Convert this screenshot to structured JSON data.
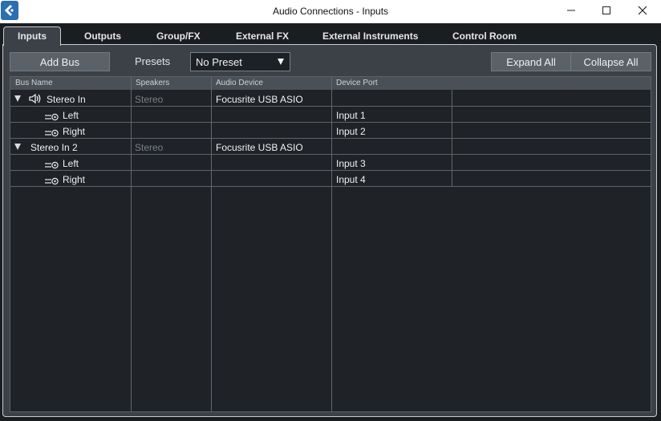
{
  "window": {
    "title": "Audio Connections - Inputs"
  },
  "tabs": [
    {
      "label": "Inputs",
      "active": true
    },
    {
      "label": "Outputs"
    },
    {
      "label": "Group/FX"
    },
    {
      "label": "External FX"
    },
    {
      "label": "External Instruments"
    },
    {
      "label": "Control Room"
    }
  ],
  "toolbar": {
    "add_bus_label": "Add Bus",
    "presets_label": "Presets",
    "preset_value": "No Preset",
    "expand_all_label": "Expand All",
    "collapse_all_label": "Collapse All"
  },
  "table": {
    "headers": [
      "Bus Name",
      "Speakers",
      "Audio Device",
      "Device Port"
    ],
    "rows": [
      {
        "name": "Stereo In",
        "speakers": "Stereo",
        "device": "Focusrite USB ASIO",
        "port": ""
      },
      {
        "name": "Left",
        "speakers": "",
        "device": "",
        "port": "Input 1"
      },
      {
        "name": "Right",
        "speakers": "",
        "device": "",
        "port": "Input 2"
      },
      {
        "name": "Stereo In 2",
        "speakers": "Stereo",
        "device": "Focusrite USB ASIO",
        "port": ""
      },
      {
        "name": "Left",
        "speakers": "",
        "device": "",
        "port": "Input 3"
      },
      {
        "name": "Right",
        "speakers": "",
        "device": "",
        "port": "Input 4"
      }
    ]
  },
  "colors": {
    "panel": "#3b4147",
    "table_bg": "#1f2226",
    "header_bg": "#4a5056",
    "app_icon": "#2a6fb0"
  }
}
